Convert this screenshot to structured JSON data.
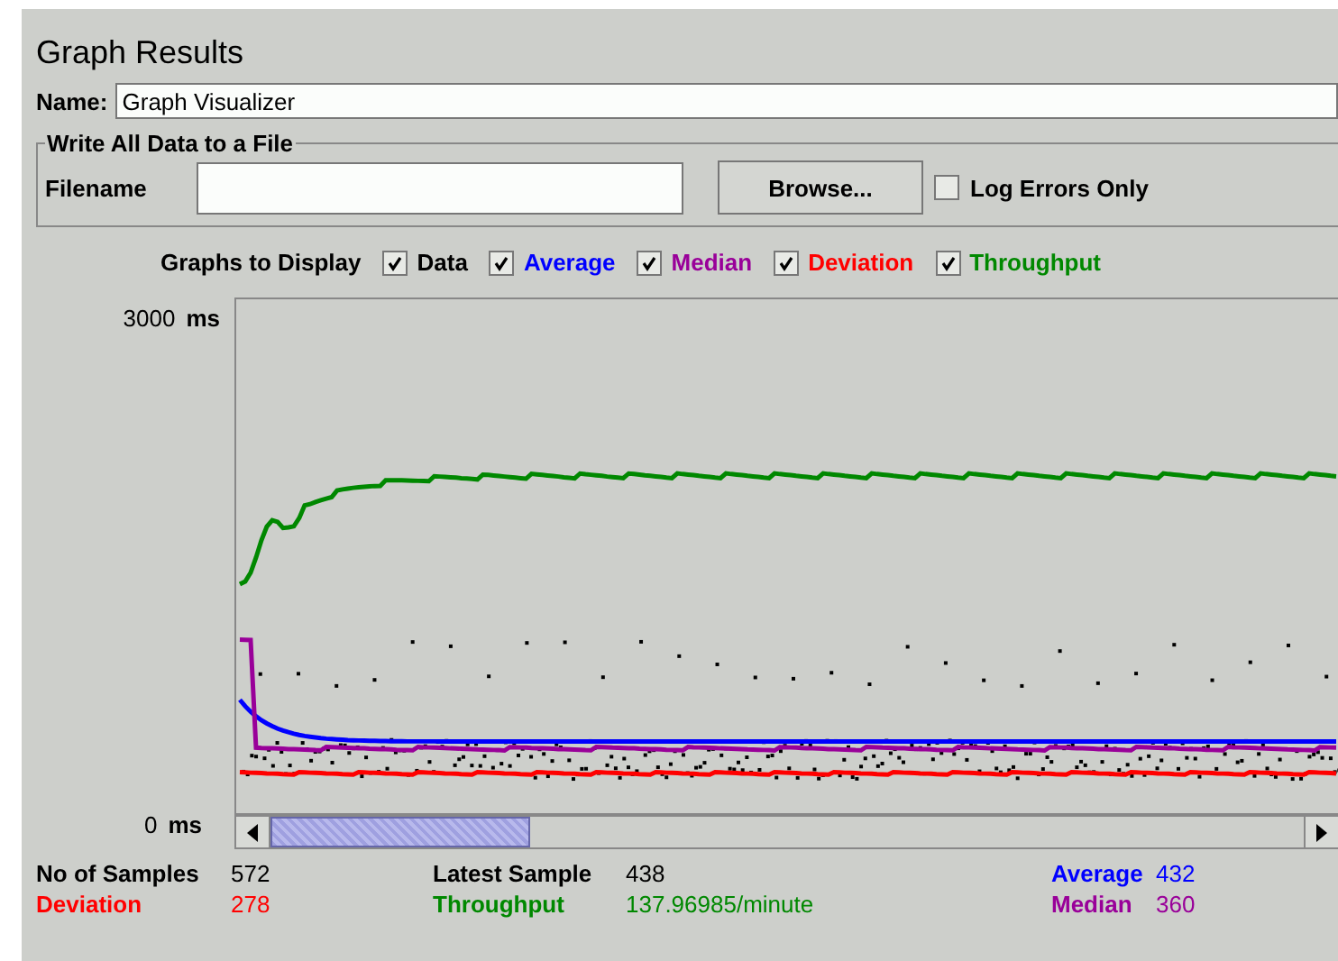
{
  "title": "Graph Results",
  "name": {
    "label": "Name:",
    "value": "Graph Visualizer"
  },
  "file_group": {
    "title": "Write All Data to a File",
    "filename_label": "Filename",
    "browse_button": "Browse...",
    "log_errors_only": {
      "label": "Log Errors Only",
      "checked": false
    }
  },
  "graphs_to_display": {
    "label": "Graphs to Display",
    "options": [
      {
        "kind": "data",
        "label": "Data",
        "checked": true,
        "color": "#000000"
      },
      {
        "kind": "average",
        "label": "Average",
        "checked": true,
        "color": "#0000ff"
      },
      {
        "kind": "median",
        "label": "Median",
        "checked": true,
        "color": "#990099"
      },
      {
        "kind": "deviation",
        "label": "Deviation",
        "checked": true,
        "color": "#ff0000"
      },
      {
        "kind": "throughput",
        "label": "Throughput",
        "checked": true,
        "color": "#008800"
      }
    ]
  },
  "graph": {
    "y_max": "3000",
    "y_min": "0",
    "unit_top": "ms",
    "unit_bottom": "ms"
  },
  "stats": [
    {
      "label": "No of Samples",
      "value": "572",
      "color": "#000000"
    },
    {
      "label": "Latest Sample",
      "value": "438",
      "color": "#000000"
    },
    {
      "label": "Average",
      "value": "432",
      "color": "#0000ff"
    },
    {
      "label": "Deviation",
      "value": "278",
      "color": "#ff0000"
    },
    {
      "label": "Throughput",
      "value": "137.96985/minute",
      "color": "#008800"
    },
    {
      "label": "Median",
      "value": "360",
      "color": "#990099"
    }
  ]
}
